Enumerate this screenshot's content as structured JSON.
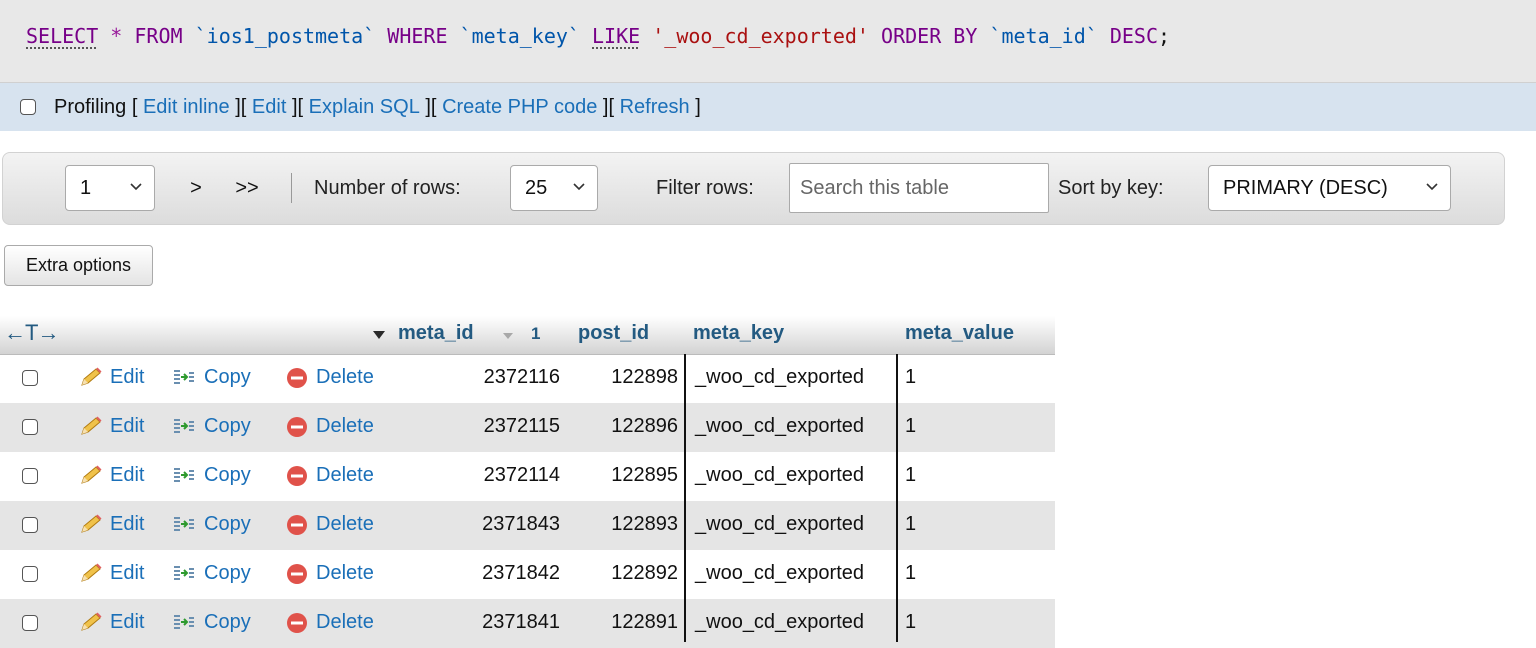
{
  "sql": {
    "select": "SELECT",
    "star": "*",
    "from": "FROM",
    "table": "`ios1_postmeta`",
    "where": "WHERE",
    "column": "`meta_key`",
    "like": "LIKE",
    "value": "'_woo_cd_exported'",
    "order_by": "ORDER BY",
    "order_col": "`meta_id`",
    "desc": "DESC",
    "semicolon": ";"
  },
  "profiling": {
    "label": "Profiling",
    "links": [
      "Edit inline",
      "Edit",
      "Explain SQL",
      "Create PHP code",
      "Refresh"
    ]
  },
  "navigation": {
    "page_select": "1",
    "next": ">",
    "last": ">>",
    "separator": "|",
    "rows_label": "Number of rows:",
    "rows_value": "25",
    "filter_label": "Filter rows:",
    "search_placeholder": "Search this table",
    "sort_label": "Sort by key:",
    "sort_value": "PRIMARY (DESC)"
  },
  "extra_options": "Extra options",
  "table": {
    "arrows": "←T→",
    "sort_index": "1",
    "columns": [
      "meta_id",
      "post_id",
      "meta_key",
      "meta_value"
    ],
    "action_labels": {
      "edit": "Edit",
      "copy": "Copy",
      "delete": "Delete"
    },
    "rows": [
      {
        "meta_id": "2372116",
        "post_id": "122898",
        "meta_key": "_woo_cd_exported",
        "meta_value": "1"
      },
      {
        "meta_id": "2372115",
        "post_id": "122896",
        "meta_key": "_woo_cd_exported",
        "meta_value": "1"
      },
      {
        "meta_id": "2372114",
        "post_id": "122895",
        "meta_key": "_woo_cd_exported",
        "meta_value": "1"
      },
      {
        "meta_id": "2371843",
        "post_id": "122893",
        "meta_key": "_woo_cd_exported",
        "meta_value": "1"
      },
      {
        "meta_id": "2371842",
        "post_id": "122892",
        "meta_key": "_woo_cd_exported",
        "meta_value": "1"
      },
      {
        "meta_id": "2371841",
        "post_id": "122891",
        "meta_key": "_woo_cd_exported",
        "meta_value": "1"
      }
    ]
  },
  "colors": {
    "link": "#1a6fb8",
    "header_text": "#235a81",
    "keyword": "#770088",
    "identifier": "#0055aa",
    "string": "#aa1111",
    "delete_icon": "#e0524a"
  }
}
